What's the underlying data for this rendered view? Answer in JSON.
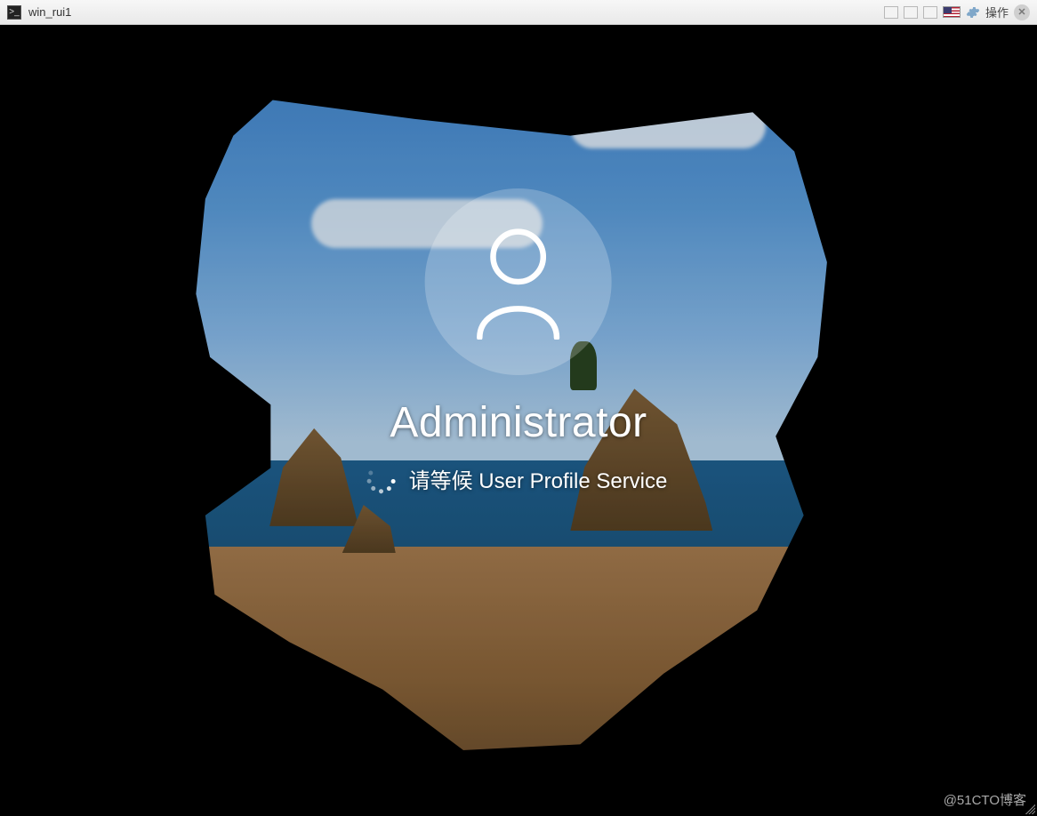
{
  "titlebar": {
    "title": "win_rui1",
    "action_label": "操作"
  },
  "login": {
    "username": "Administrator",
    "status_text": "请等候 User Profile Service"
  },
  "watermark": "@51CTO博客"
}
